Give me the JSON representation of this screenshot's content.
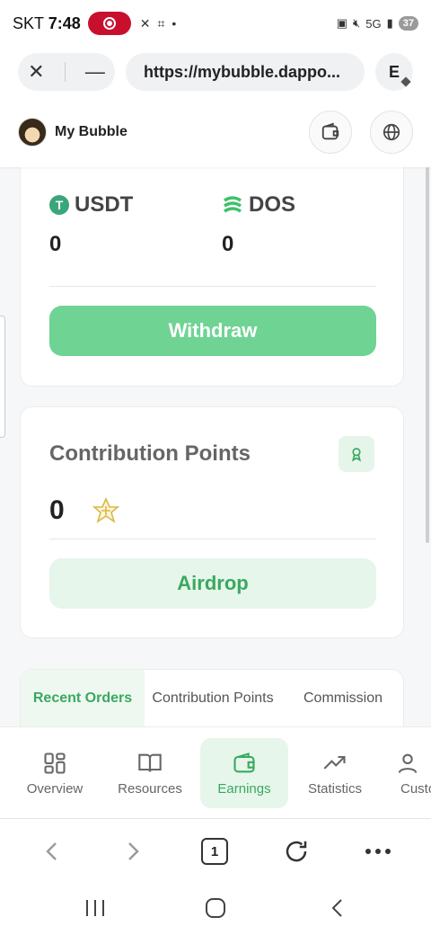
{
  "status_bar": {
    "carrier": "SKT",
    "time": "7:48",
    "battery": "37"
  },
  "browser": {
    "url": "https://mybubble.dappo...",
    "profile_initial": "E",
    "tab_count": "1"
  },
  "header": {
    "app_name": "My Bubble"
  },
  "balances": {
    "tokens": [
      {
        "name": "USDT",
        "value": "0"
      },
      {
        "name": "DOS",
        "value": "0"
      }
    ],
    "withdraw_label": "Withdraw"
  },
  "contribution": {
    "title": "Contribution Points",
    "value": "0",
    "airdrop_label": "Airdrop"
  },
  "orders_tabs": [
    {
      "label": "Recent Orders",
      "active": true
    },
    {
      "label": "Contribution Points",
      "active": false
    },
    {
      "label": "Commission",
      "active": false
    }
  ],
  "nav": {
    "items": [
      {
        "label": "Overview",
        "icon": "grid-icon"
      },
      {
        "label": "Resources",
        "icon": "book-icon"
      },
      {
        "label": "Earnings",
        "icon": "wallet-icon",
        "active": true
      },
      {
        "label": "Statistics",
        "icon": "trend-icon"
      },
      {
        "label": "Custo",
        "icon": "user-icon"
      }
    ]
  },
  "colors": {
    "accent": "#3aa860",
    "withdraw_bg": "#6fd394",
    "accent_light": "#e6f6ea"
  }
}
